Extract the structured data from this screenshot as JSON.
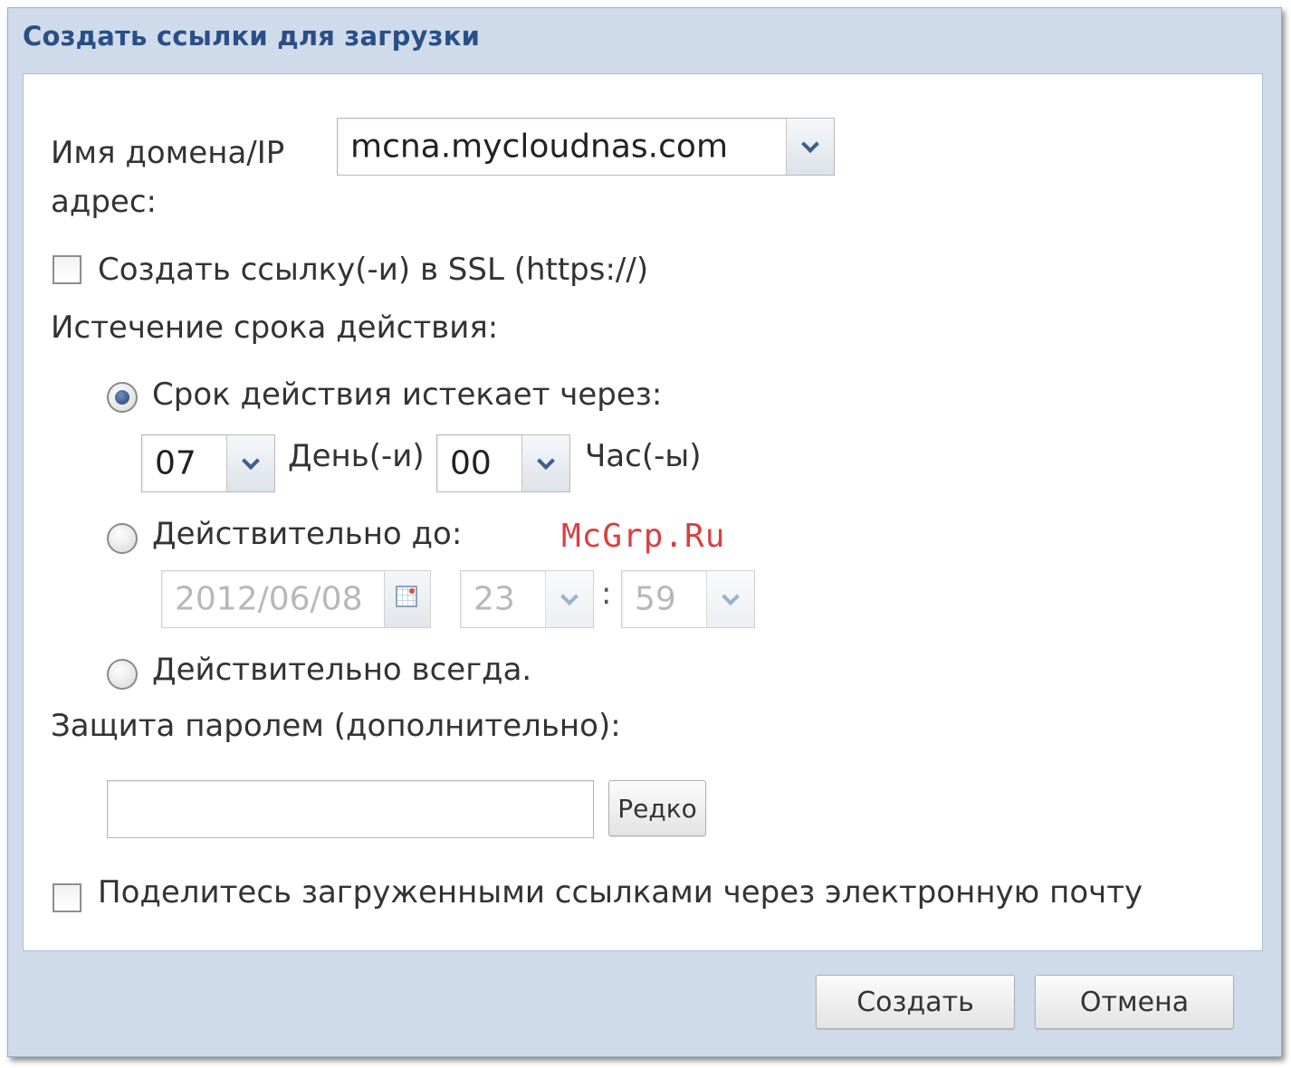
{
  "dialog": {
    "title": "Создать ссылки для загрузки",
    "domain": {
      "label": "Имя домена/IP адрес:",
      "value": "mcna.mycloudnas.com"
    },
    "ssl": {
      "label": "Создать ссылку(-и) в SSL (https://)",
      "checked": false
    },
    "expiration": {
      "label": "Истечение срока действия:",
      "expires_in": {
        "label": "Срок действия истекает через:",
        "selected": true,
        "days_value": "07",
        "days_label": "День(-и)",
        "hours_value": "00",
        "hours_label": "Час(-ы)"
      },
      "valid_until": {
        "label": "Действительно до:",
        "selected": false,
        "date_value": "2012/06/08",
        "hour_value": "23",
        "separator": ":",
        "minute_value": "59"
      },
      "always": {
        "label": "Действительно всегда.",
        "selected": false
      }
    },
    "password": {
      "label": "Защита паролем (дополнительно):",
      "value": "",
      "edit_button": "Редко"
    },
    "share_email": {
      "label": "Поделитесь загруженными ссылками через электронную почту",
      "checked": false
    },
    "buttons": {
      "create": "Создать",
      "cancel": "Отмена"
    }
  },
  "watermark": "McGrp.Ru",
  "colors": {
    "title": "#2a4f86",
    "frame": "#cfdbea",
    "watermark": "#d94040"
  }
}
